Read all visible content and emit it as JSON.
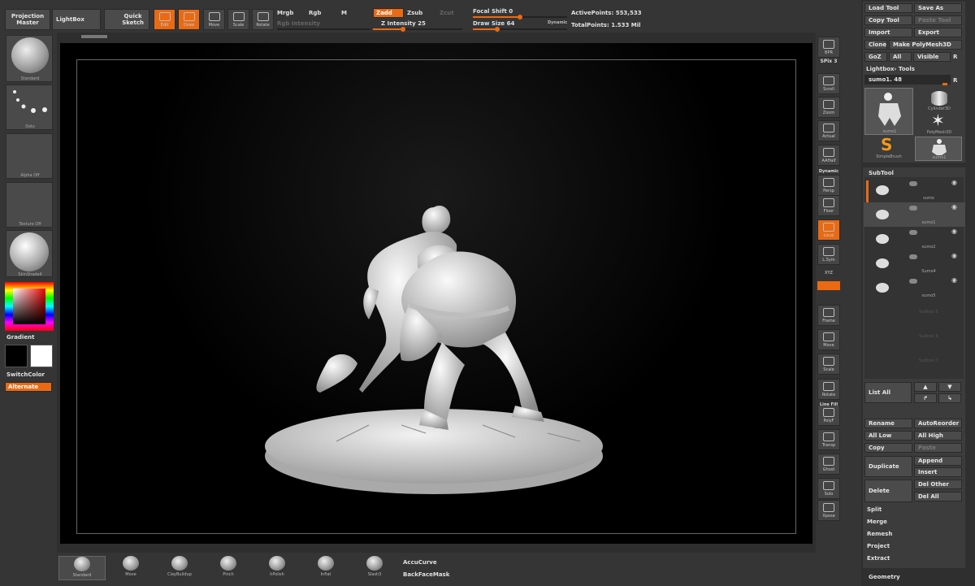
{
  "top": {
    "projection_master": "Projection\nMaster",
    "lightbox": "LightBox",
    "quick_sketch": "Quick\nSketch",
    "modes": [
      {
        "label": "Edit",
        "icon": "edit-icon",
        "active": true
      },
      {
        "label": "Draw",
        "icon": "draw-icon",
        "active": true
      },
      {
        "label": "Move",
        "icon": "move-icon",
        "active": false
      },
      {
        "label": "Scale",
        "icon": "scale-icon",
        "active": false
      },
      {
        "label": "Rotate",
        "icon": "rotate-icon",
        "active": false
      }
    ],
    "mrgb": "Mrgb",
    "rgb": "Rgb",
    "m": "M",
    "rgb_intensity": "Rgb Intensity",
    "zadd": "Zadd",
    "zsub": "Zsub",
    "zcut": "Zcut",
    "z_intensity": "Z Intensity 25",
    "focal_shift": "Focal Shift 0",
    "draw_size": "Draw Size 64",
    "dynamic": "Dynamic",
    "active_points": "ActivePoints: 553,533",
    "total_points": "TotalPoints: 1.533 Mil"
  },
  "left": {
    "brush": "Standard",
    "stroke": "Dots",
    "alpha": "Alpha Off",
    "texture": "Texture Off",
    "material": "SkinShade4",
    "gradient": "Gradient",
    "switch_color": "SwitchColor",
    "alternate": "Alternate"
  },
  "right_tools": [
    {
      "label": "BPR",
      "icon": "bpr-icon",
      "active": false
    },
    {
      "label": "Scroll",
      "icon": "scroll-icon",
      "active": false
    },
    {
      "label": "Zoom",
      "icon": "zoom-icon",
      "active": false
    },
    {
      "label": "Actual",
      "icon": "actual-icon",
      "active": false
    },
    {
      "label": "AAHalf",
      "icon": "aahalf-icon",
      "active": false
    },
    {
      "label": "Persp",
      "icon": "persp-icon",
      "active": false
    },
    {
      "label": "Floor",
      "icon": "floor-icon",
      "active": false
    },
    {
      "label": "Local",
      "icon": "local-icon",
      "active": true
    },
    {
      "label": "L.Sym",
      "icon": "lsym-icon",
      "active": false
    },
    {
      "label": "Frame",
      "icon": "frame-icon",
      "active": false
    },
    {
      "label": "Move",
      "icon": "move-view-icon",
      "active": false
    },
    {
      "label": "Scale",
      "icon": "scale-view-icon",
      "active": false
    },
    {
      "label": "Rotate",
      "icon": "rotate-view-icon",
      "active": false
    },
    {
      "label": "PolyF",
      "icon": "polyf-icon",
      "active": false
    },
    {
      "label": "Transp",
      "icon": "transp-icon",
      "active": false
    },
    {
      "label": "Ghost",
      "icon": "ghost-icon",
      "active": false
    },
    {
      "label": "Solo",
      "icon": "solo-icon",
      "active": false
    },
    {
      "label": "Xpose",
      "icon": "xpose-icon",
      "active": false
    }
  ],
  "right_extra": {
    "spix": "SPix 3",
    "dynamic": "Dynamic",
    "xyz": "XYZ",
    "line_fill": "Line Fill"
  },
  "tool": {
    "load_tool": "Load Tool",
    "save_as": "Save As",
    "copy_tool": "Copy Tool",
    "paste_tool": "Paste Tool",
    "import": "Import",
    "export": "Export",
    "clone": "Clone",
    "make_polymesh": "Make PolyMesh3D",
    "goz": "GoZ",
    "all": "All",
    "visible": "Visible",
    "r": "R",
    "lightbox_tools": "Lightbox› Tools",
    "current_tool": "sumo1. 48",
    "thumbs": [
      "sumo1",
      "Cylinder3D",
      "PolyMesh3D",
      "SimpleBrush",
      "sumo1"
    ]
  },
  "subtool": {
    "title": "SubTool",
    "items": [
      "sumo",
      "sumo1",
      "sumo2",
      "Sumo4",
      "sumo5",
      "Subtool 5",
      "Subtool 6",
      "Subtool 7"
    ],
    "list_all": "List All",
    "rename": "Rename",
    "autoreorder": "AutoReorder",
    "all_low": "All Low",
    "all_high": "All High",
    "copy": "Copy",
    "paste": "Paste",
    "duplicate": "Duplicate",
    "append": "Append",
    "insert": "Insert",
    "delete": "Delete",
    "del_other": "Del Other",
    "del_all": "Del All",
    "split": "Split",
    "merge": "Merge",
    "remesh": "Remesh",
    "project": "Project",
    "extract": "Extract",
    "geometry": "Geometry"
  },
  "bottom": {
    "brushes": [
      "Standard",
      "Move",
      "ClayBuildup",
      "Pinch",
      "hPolish",
      "Inflat",
      "Slash3"
    ],
    "accucurve": "AccuCurve",
    "backfacemask": "BackFaceMask"
  },
  "colors": {
    "accent": "#e96a13",
    "panel": "#3a3a3a",
    "button": "#4b4b4b",
    "canvas": "#000000"
  }
}
